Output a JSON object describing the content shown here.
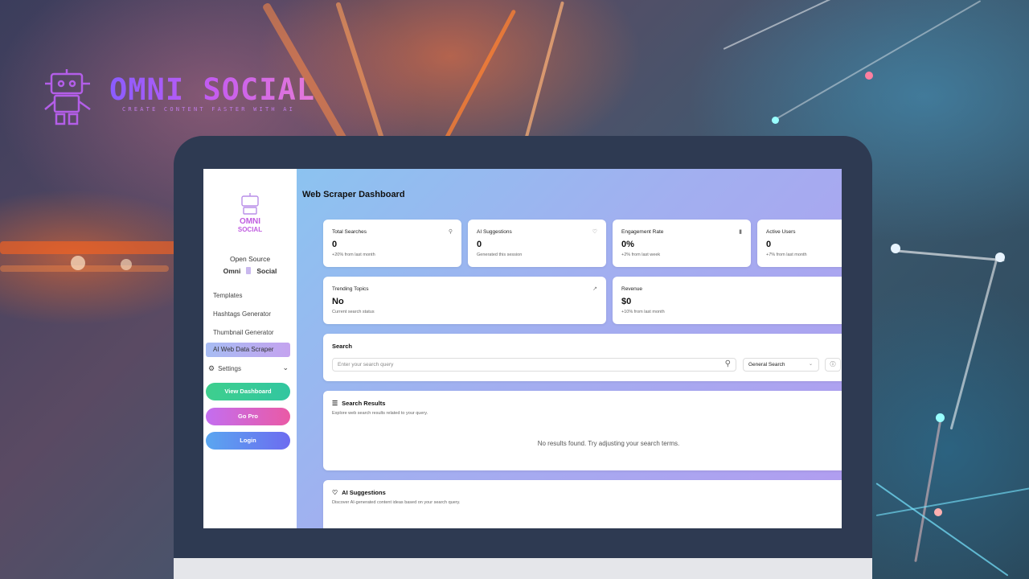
{
  "brand": {
    "title": "OMNI SOCIAL",
    "tagline": "CREATE CONTENT FASTER WITH AI"
  },
  "sidebar": {
    "logo_line1": "OMNI",
    "logo_line2": "SOCIAL",
    "open_source": "Open Source",
    "omni": "Omni",
    "social": "Social",
    "items": [
      {
        "label": "Templates"
      },
      {
        "label": "Hashtags Generator"
      },
      {
        "label": "Thumbnail Generator"
      },
      {
        "label": "AI Web Data Scraper",
        "active": true
      }
    ],
    "settings_label": "Settings",
    "buttons": {
      "view_dashboard": "View Dashboard",
      "go_pro": "Go Pro",
      "login": "Login"
    }
  },
  "main": {
    "title": "Web Scraper Dashboard",
    "stats": [
      {
        "label": "Total Searches",
        "value": "0",
        "sub": "+20% from last month",
        "icon": "search-icon"
      },
      {
        "label": "AI Suggestions",
        "value": "0",
        "sub": "Generated this session",
        "icon": "lightbulb-icon"
      },
      {
        "label": "Engagement Rate",
        "value": "0%",
        "sub": "+2% from last week",
        "icon": "bar-chart-icon"
      },
      {
        "label": "Active Users",
        "value": "0",
        "sub": "+7% from last month",
        "icon": ""
      },
      {
        "label": "Trending Topics",
        "value": "No",
        "sub": "Current search status",
        "icon": "trending-up-icon"
      },
      {
        "label": "Revenue",
        "value": "$0",
        "sub": "+10% from last month",
        "icon": ""
      }
    ],
    "search": {
      "title": "Search",
      "placeholder": "Enter your search query",
      "select_value": "General Search"
    },
    "results": {
      "title": "Search Results",
      "subtitle": "Explore web search results related to your query.",
      "empty": "No results found. Try adjusting your search terms."
    },
    "ai": {
      "title": "AI Suggestions",
      "subtitle": "Discover AI-generated content ideas based on your search query."
    }
  },
  "colors": {
    "view_dashboard": "#3ecf8e",
    "go_pro": "#d65fd8",
    "login": "#5b8cf0"
  }
}
